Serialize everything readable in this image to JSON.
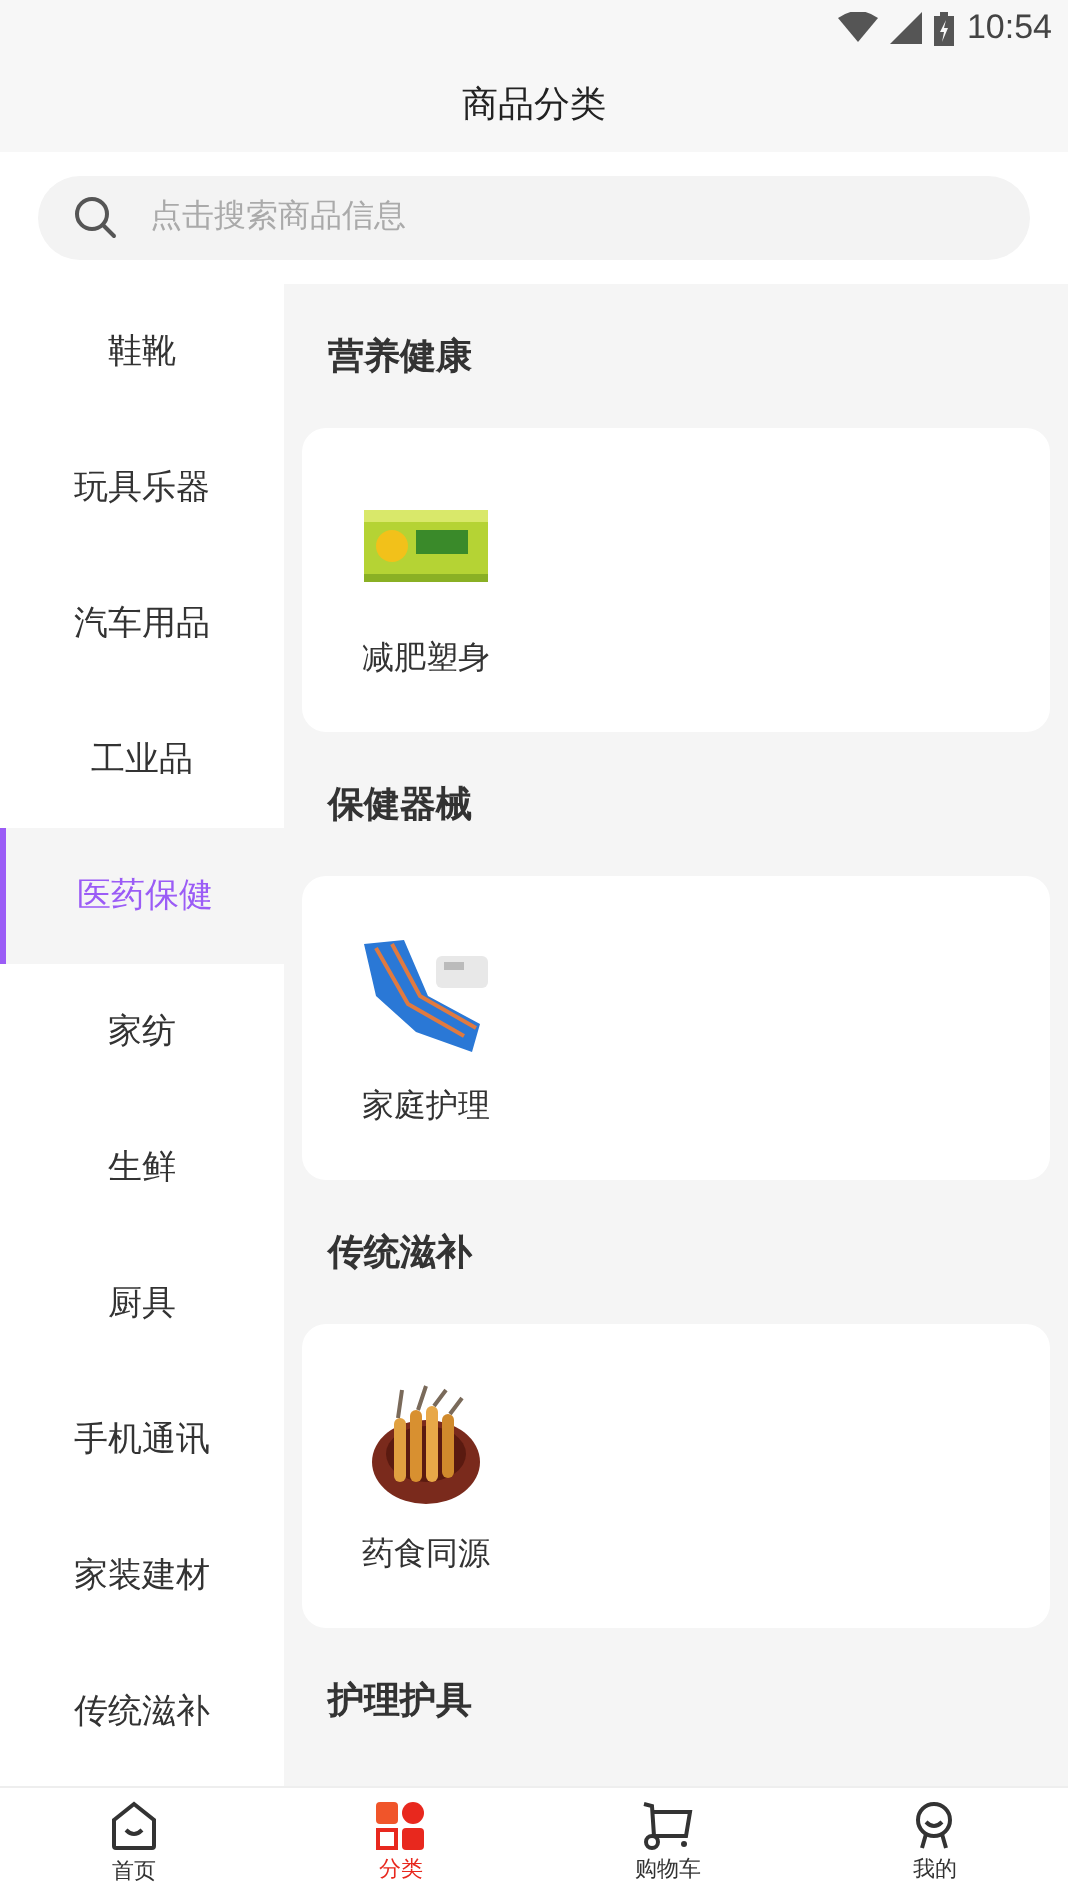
{
  "status_bar": {
    "time": "10:54"
  },
  "header": {
    "title": "商品分类"
  },
  "search": {
    "placeholder": "点击搜索商品信息"
  },
  "sidebar": {
    "items": [
      {
        "label": "鞋靴",
        "selected": false
      },
      {
        "label": "玩具乐器",
        "selected": false
      },
      {
        "label": "汽车用品",
        "selected": false
      },
      {
        "label": "工业品",
        "selected": false
      },
      {
        "label": "医药保健",
        "selected": true
      },
      {
        "label": "家纺",
        "selected": false
      },
      {
        "label": "生鲜",
        "selected": false
      },
      {
        "label": "厨具",
        "selected": false
      },
      {
        "label": "手机通讯",
        "selected": false
      },
      {
        "label": "家装建材",
        "selected": false
      },
      {
        "label": "传统滋补",
        "selected": false
      }
    ]
  },
  "sections": [
    {
      "title": "营养健康",
      "items": [
        {
          "label": "减肥塑身",
          "kind": "box"
        }
      ]
    },
    {
      "title": "保健器械",
      "items": [
        {
          "label": "家庭护理",
          "kind": "mattress"
        }
      ]
    },
    {
      "title": "传统滋补",
      "items": [
        {
          "label": "药食同源",
          "kind": "bowl"
        }
      ]
    },
    {
      "title": "护理护具"
    }
  ],
  "tab_bar": [
    {
      "label": "首页",
      "kind": "home",
      "selected": false
    },
    {
      "label": "分类",
      "kind": "category",
      "selected": true
    },
    {
      "label": "购物车",
      "kind": "cart",
      "selected": false
    },
    {
      "label": "我的",
      "kind": "user",
      "selected": false
    }
  ]
}
